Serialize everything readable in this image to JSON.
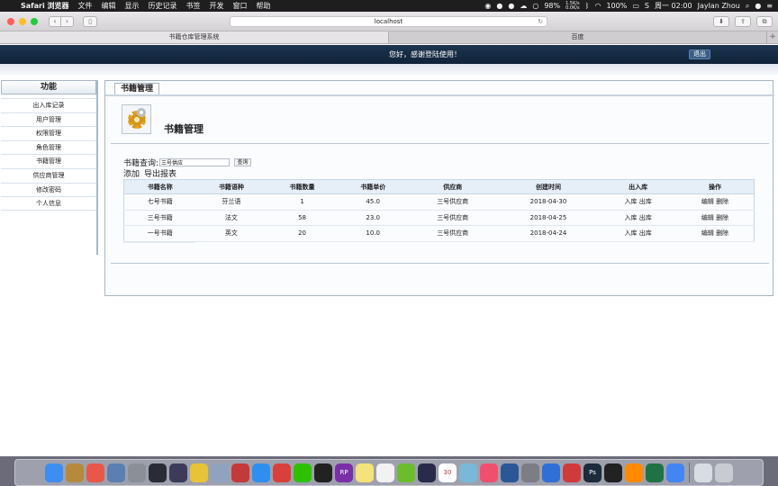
{
  "menubar": {
    "app": "Safari 浏览器",
    "menus": [
      "文件",
      "编辑",
      "显示",
      "历史记录",
      "书签",
      "开发",
      "窗口",
      "帮助"
    ],
    "battery": "98%",
    "net_up": "1.5K/s",
    "net_down": "0.0K/s",
    "wifi_strength": "100%",
    "clock": "周一 02:00",
    "user": "Jaylan Zhou"
  },
  "browser": {
    "url": "localhost",
    "tabs": [
      "书籍仓库管理系统",
      "百度"
    ]
  },
  "banner": {
    "welcome": "您好，感谢登陆使用！",
    "logout": "退出"
  },
  "sidebar": {
    "title": "功能",
    "items": [
      "出入库记录",
      "用户管理",
      "权限管理",
      "角色管理",
      "书籍管理",
      "供应商管理",
      "修改密码",
      "个人信息"
    ]
  },
  "main": {
    "tab_label": "书籍管理",
    "heading": "书籍管理",
    "query_label": "书籍查询:",
    "query_value": "三号供应",
    "query_button": "查询",
    "add_label": "添加",
    "export_label": "导出报表"
  },
  "table": {
    "headers": [
      "书籍名称",
      "书籍语种",
      "书籍数量",
      "书籍单价",
      "供应商",
      "创建时间",
      "出入库",
      "操作"
    ],
    "rows": [
      {
        "name": "七号书籍",
        "lang": "芬兰语",
        "qty": "1",
        "price": "45.0",
        "supplier": "三号供应商",
        "created": "2018-04-30",
        "in": "入库",
        "out": "出库",
        "edit": "编辑",
        "del": "删除"
      },
      {
        "name": "三号书籍",
        "lang": "法文",
        "qty": "58",
        "price": "23.0",
        "supplier": "三号供应商",
        "created": "2018-04-25",
        "in": "入库",
        "out": "出库",
        "edit": "编辑",
        "del": "删除"
      },
      {
        "name": "一号书籍",
        "lang": "英文",
        "qty": "20",
        "price": "10.0",
        "supplier": "三号供应商",
        "created": "2018-04-24",
        "in": "入库",
        "out": "出库",
        "edit": "编辑",
        "del": "删除"
      }
    ]
  },
  "dock": {
    "apps": [
      "finder-icon",
      "notes-icon",
      "photos-icon",
      "preview-icon",
      "launchpad-icon",
      "intellij-icon",
      "terminal-icon",
      "bee-icon",
      "db-icon",
      "ruby-icon",
      "safari-icon",
      "presentation-icon",
      "wechat-icon",
      "qq-icon",
      "axure-icon",
      "stickies-icon",
      "textedit-icon",
      "qq-browser-icon",
      "app-icon",
      "calendar-icon",
      "maps-icon",
      "music-icon",
      "word-icon",
      "system-prefs-icon",
      "baidu-netdisk-icon",
      "teamviewer-icon",
      "photoshop-icon",
      "qq2-icon",
      "sublime-icon",
      "excel-icon",
      "chrome-icon",
      "folder-icon",
      "trash-icon"
    ],
    "calendar_day": "30",
    "rp_label": "RP",
    "ps_label": "Ps"
  }
}
